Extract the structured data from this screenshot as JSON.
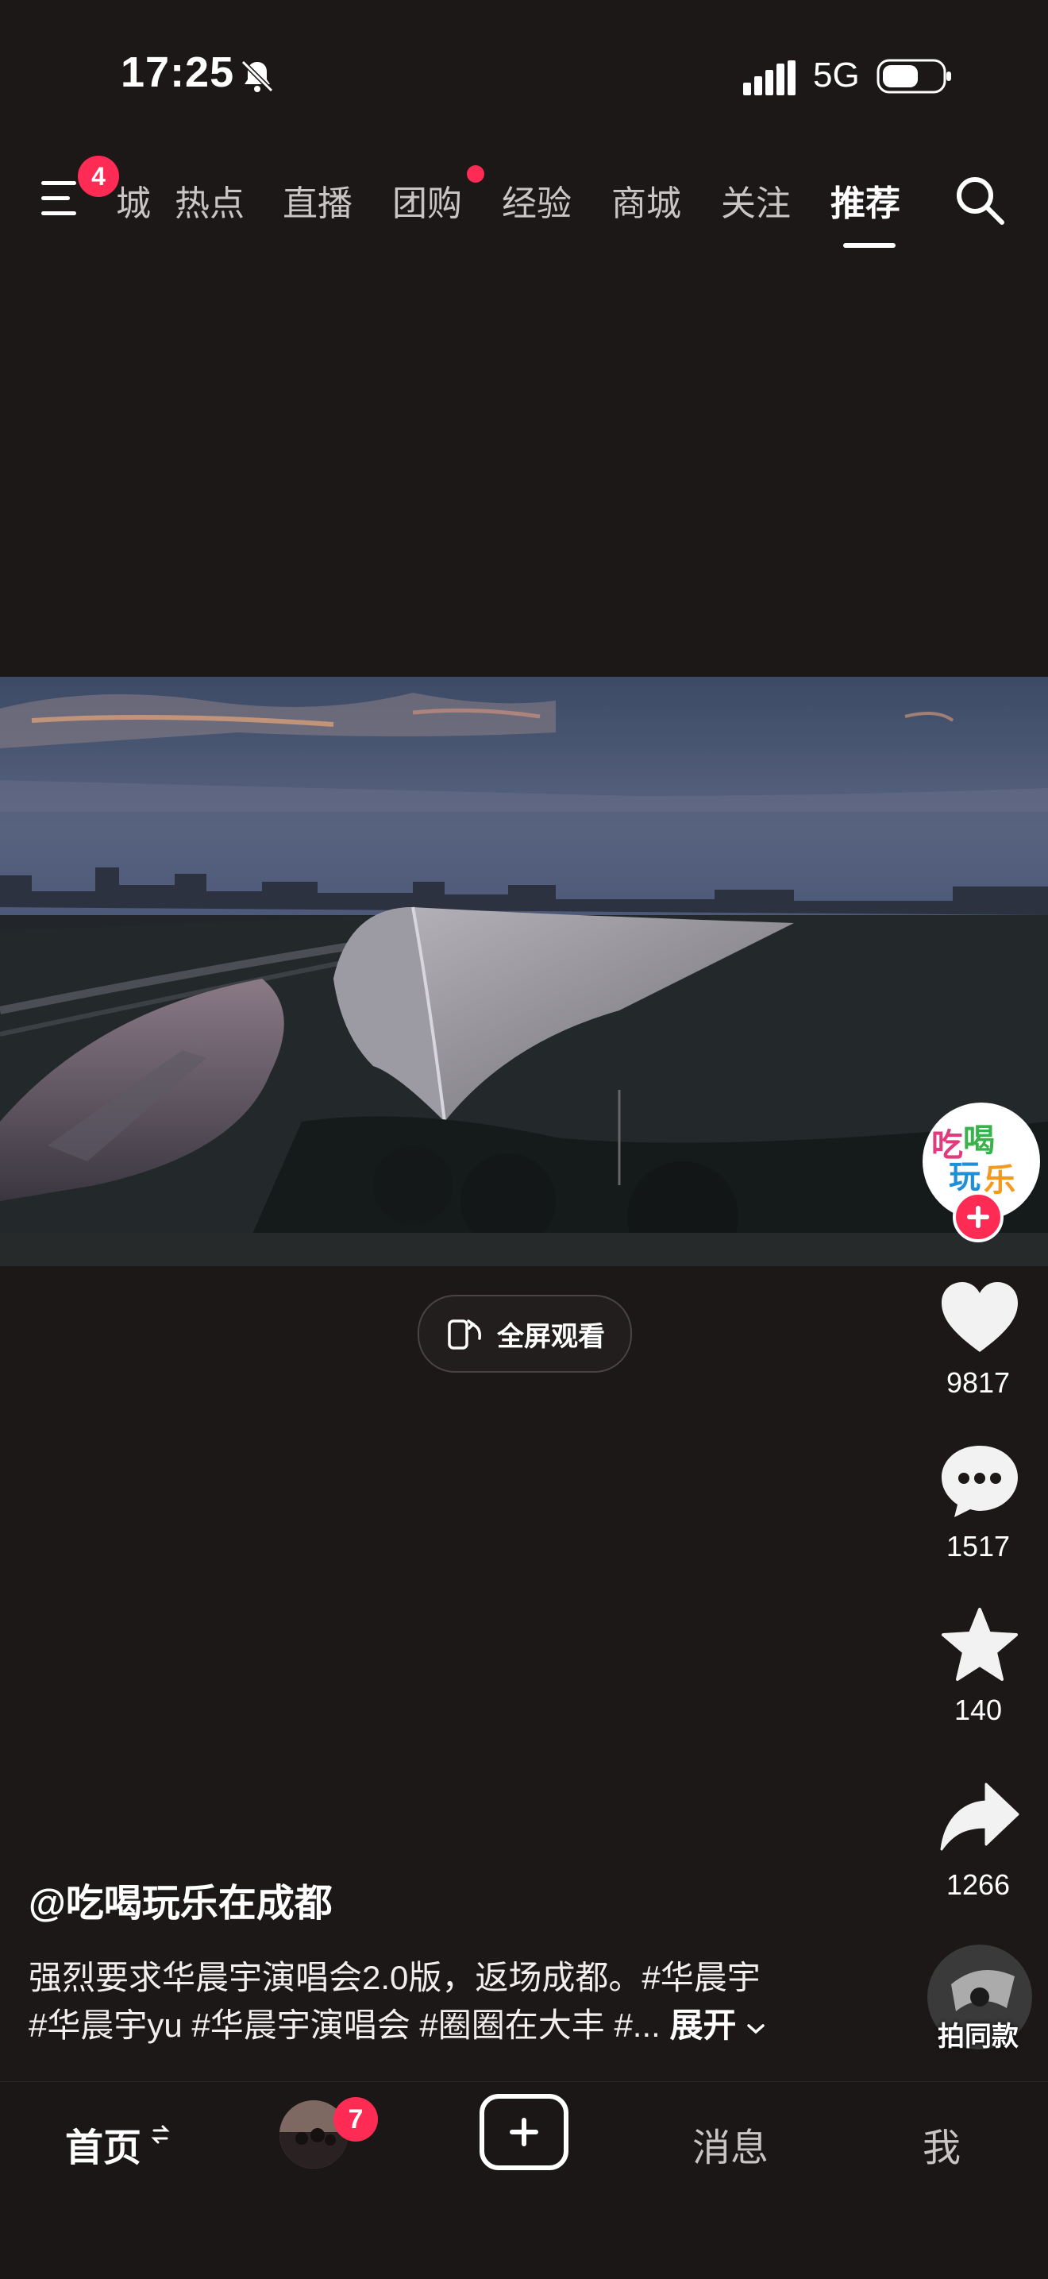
{
  "status_bar": {
    "time": "17:25",
    "network": "5G",
    "icons": [
      "bell-muted-icon",
      "signal-icon",
      "battery-icon"
    ]
  },
  "top_tabs": {
    "menu_badge": "4",
    "items": [
      {
        "label": "城",
        "partial": true
      },
      {
        "label": "热点"
      },
      {
        "label": "直播"
      },
      {
        "label": "团购",
        "dot": true
      },
      {
        "label": "经验"
      },
      {
        "label": "商城"
      },
      {
        "label": "关注"
      },
      {
        "label": "推荐",
        "active": true
      }
    ],
    "icons": [
      "menu-icon",
      "search-icon"
    ]
  },
  "video": {
    "fullscreen_label": "全屏观看"
  },
  "side_actions": {
    "avatar_text": "吃喝玩乐",
    "likes": "9817",
    "comments": "1517",
    "favorites": "140",
    "shares": "1266",
    "same_music_label": "拍同款"
  },
  "caption": {
    "author": "@吃喝玩乐在成都",
    "line1": "强烈要求华晨宇演唱会2.0版，返场成都。#华晨宇",
    "line2": "#华晨宇yu #华晨宇演唱会 #圈圈在大丰 #...",
    "expand": "展开"
  },
  "bottom_nav": {
    "home": "首页",
    "friends_badge": "7",
    "messages": "消息",
    "me": "我"
  },
  "colors": {
    "background": "#1c1817",
    "accent": "#fe2c55"
  }
}
